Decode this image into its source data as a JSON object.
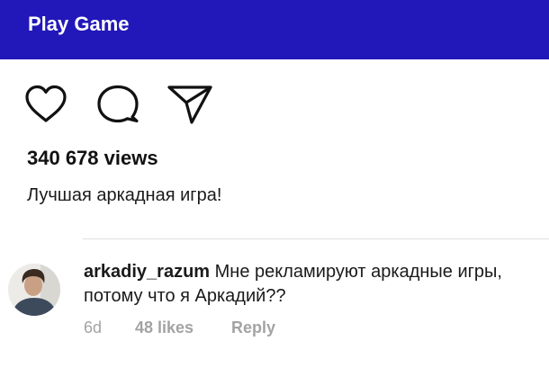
{
  "header": {
    "title": "Play Game",
    "color": "#2218b9"
  },
  "post": {
    "actions": [
      {
        "icon": "heart-icon"
      },
      {
        "icon": "comment-bubble-icon"
      },
      {
        "icon": "paper-plane-icon"
      }
    ],
    "views": "340 678 views",
    "caption": "Лучшая аркадная игра!"
  },
  "comment": {
    "username": "arkadiy_razum",
    "text": "Мне рекламируют аркадные игры, потому что я Аркадий??",
    "time": "6d",
    "likes": "48 likes",
    "reply_label": "Reply"
  }
}
